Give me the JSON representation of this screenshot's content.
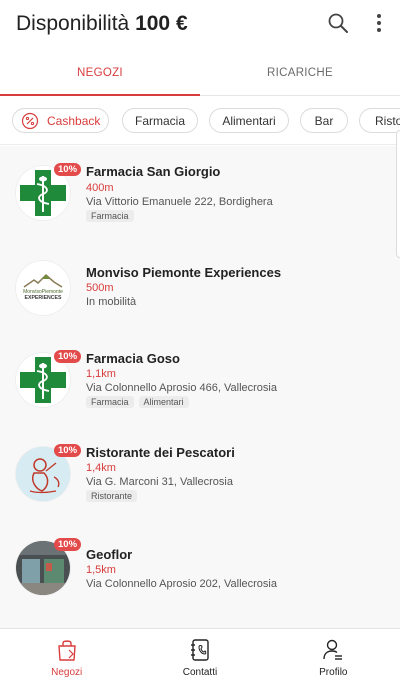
{
  "header": {
    "title_prefix": "Disponibilità",
    "title_amount": "100 €"
  },
  "tabs": [
    {
      "label": "NEGOZI",
      "active": true
    },
    {
      "label": "RICARICHE",
      "active": false
    }
  ],
  "chips": [
    {
      "label": "Cashback"
    },
    {
      "label": "Farmacia"
    },
    {
      "label": "Alimentari"
    },
    {
      "label": "Bar"
    },
    {
      "label": "Risto"
    }
  ],
  "stores": [
    {
      "name": "Farmacia San Giorgio",
      "badge": "10%",
      "distance": "400m",
      "address": "Via Vittorio Emanuele 222, Bordighera",
      "tags": [
        "Farmacia"
      ],
      "logo": "pharmacy-cross-icon"
    },
    {
      "name": "Monviso Piemonte Experiences",
      "badge": "",
      "distance": "500m",
      "address": "In mobilità",
      "tags": [],
      "logo": "monviso-logo",
      "logo_text_top": "MonvisoPiemonte",
      "logo_text_bottom": "EXPERIENCES"
    },
    {
      "name": "Farmacia Goso",
      "badge": "10%",
      "distance": "1,1km",
      "address": "Via Colonnello Aprosio 466, Vallecrosia",
      "tags": [
        "Farmacia",
        "Alimentari"
      ],
      "logo": "pharmacy-cross-icon"
    },
    {
      "name": "Ristorante dei Pescatori",
      "badge": "10%",
      "distance": "1,4km",
      "address": "Via G. Marconi 31, Vallecrosia",
      "tags": [
        "Ristorante"
      ],
      "logo": "fisherman-illustration"
    },
    {
      "name": "Geoflor",
      "badge": "10%",
      "distance": "1,5km",
      "address": "Via Colonnello Aprosio 202, Vallecrosia",
      "tags": [],
      "logo": "shop-photo"
    }
  ],
  "bottom_nav": [
    {
      "label": "Negozi",
      "icon": "shopping-bag-icon",
      "active": true
    },
    {
      "label": "Contatti",
      "icon": "contacts-book-icon",
      "active": false
    },
    {
      "label": "Profilo",
      "icon": "user-profile-icon",
      "active": false
    }
  ],
  "colors": {
    "accent": "#d93c3c",
    "badge": "#e34a4a",
    "pharmacy_green": "#1e8a3a"
  }
}
